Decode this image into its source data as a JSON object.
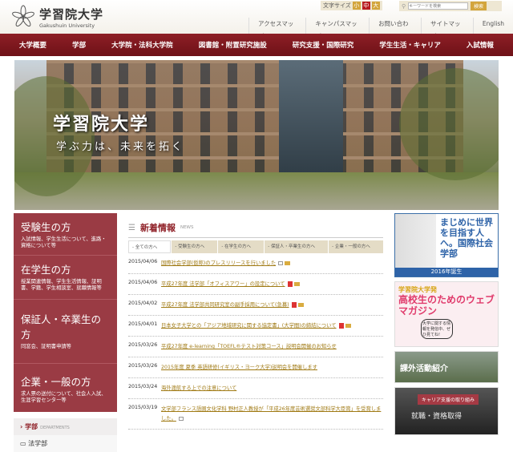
{
  "header": {
    "logo_jp": "学習院大学",
    "logo_en": "Gakushuin University",
    "font_size_label": "文字サイズ",
    "font_sizes": [
      "小",
      "中",
      "大"
    ],
    "search_placeholder": "キーワードを検索",
    "search_button": "検索",
    "util_links": [
      "アクセスマップ",
      "キャンパスマップ",
      "お問い合わせ",
      "サイトマップ",
      "English"
    ]
  },
  "nav": [
    "大学概要",
    "学部",
    "大学院・法科大学院",
    "図書館・附置研究施設",
    "研究支援・国際研究",
    "学生生活・キャリア",
    "入試情報"
  ],
  "hero": {
    "title": "学習院大学",
    "tagline": "学ぶ力は、未来を拓く"
  },
  "left_panel": [
    {
      "title": "受験生の方",
      "desc": "入試情報、学生生活について、進路・資格について等"
    },
    {
      "title": "在学生の方",
      "desc": "授業関連情報、学生生活情報、証明書、学籍、学生相談室、就職情報等"
    },
    {
      "title": "保証人・卒業生の方",
      "desc": "同窓会、証明書申請等"
    },
    {
      "title": "企業・一般の方",
      "desc": "求人票の送付について、社会人入試、生涯学習センター等"
    }
  ],
  "departments": {
    "title": "学部",
    "subtitle": "DEPARTMENTS",
    "first": "法学部"
  },
  "news": {
    "title": "新着情報",
    "subtitle": "NEWS",
    "tabs": [
      "全ての方へ",
      "受験生の方へ",
      "在学生の方へ",
      "保証人・卒業生の方へ",
      "企業・一般の方へ"
    ],
    "items": [
      {
        "date": "2015/04/06",
        "text": "国際社会学部(仮称)のプレスリリースを行いました"
      },
      {
        "date": "2015/04/06",
        "text": "平成27年度 法学部「オフィスアワー」の設定について"
      },
      {
        "date": "2015/04/02",
        "text": "平成27年度 法学部共同研究室の副手採用について(急募)"
      },
      {
        "date": "2015/04/01",
        "text": "日本女子大学との「アジア地域研究に関する協定書」(大学間)の締結について"
      },
      {
        "date": "2015/03/26",
        "text": "平成27年度 e-learning「TOEFL®テスト対策コース」説明会開催のお知らせ"
      },
      {
        "date": "2015/03/26",
        "text": "2015年度 夏季 英語研修(イギリス・ヨーク大学)説明会を開催します"
      },
      {
        "date": "2015/03/24",
        "text": "海外渡航する上での注意について"
      },
      {
        "date": "2015/03/19",
        "text": "文学部フランス語圏文化学科 野村正人教授が「平成26年度芸術選奨文部科学大臣賞」を受賞しました。"
      }
    ]
  },
  "banners": {
    "b1_text": "まじめに世界を目指す人へ。国際社会学部",
    "b1_footer": "2016年誕生",
    "b2_a": "学習院大学発",
    "b2_b": "高校生のためのウェブマガジン",
    "b2_c": "大学に関する情報を発信中、ぜひ見てね!",
    "b3": "課外活動紹介",
    "b4_tag": "キャリア支援の取り組み",
    "b4_text": "就職・資格取得"
  }
}
